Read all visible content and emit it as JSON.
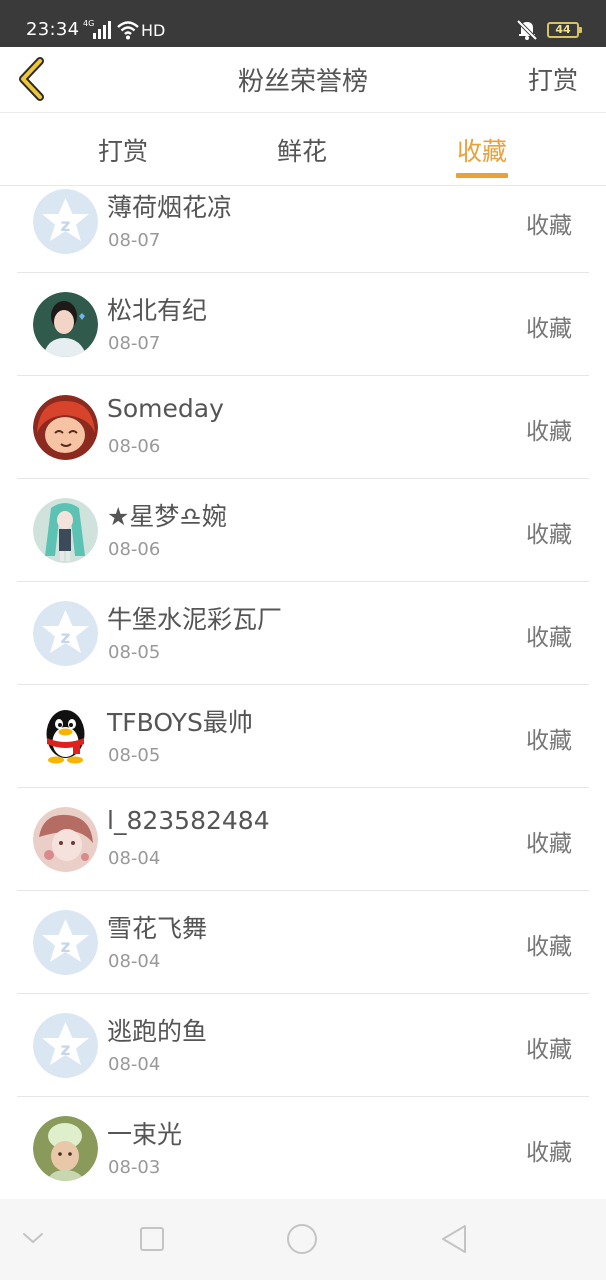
{
  "status": {
    "time": "23:34",
    "network": "4G",
    "hd": "HD",
    "battery": "44"
  },
  "header": {
    "title": "粉丝荣誉榜",
    "action": "打赏"
  },
  "tabs": [
    {
      "label": "打赏",
      "active": false
    },
    {
      "label": "鲜花",
      "active": false
    },
    {
      "label": "收藏",
      "active": true
    }
  ],
  "colors": {
    "accent": "#e9a13c",
    "status_bar": "#3a3a3a"
  },
  "fans": [
    {
      "name": "薄荷烟花凉",
      "date": "08-07",
      "action": "收藏",
      "avatar": "default-star-avatar"
    },
    {
      "name": "松北有纪",
      "date": "08-07",
      "action": "收藏",
      "avatar": "photo-avatar"
    },
    {
      "name": "Someday",
      "date": "08-06",
      "action": "收藏",
      "avatar": "anime-avatar"
    },
    {
      "name": "★星梦♎婉",
      "date": "08-06",
      "action": "收藏",
      "avatar": "anime-avatar"
    },
    {
      "name": "牛堡水泥彩瓦厂",
      "date": "08-05",
      "action": "收藏",
      "avatar": "default-star-avatar"
    },
    {
      "name": "TFBOYS最帅",
      "date": "08-05",
      "action": "收藏",
      "avatar": "penguin-avatar"
    },
    {
      "name": "l_823582484",
      "date": "08-04",
      "action": "收藏",
      "avatar": "illustration-avatar"
    },
    {
      "name": "雪花飞舞",
      "date": "08-04",
      "action": "收藏",
      "avatar": "default-star-avatar"
    },
    {
      "name": "逃跑的鱼",
      "date": "08-04",
      "action": "收藏",
      "avatar": "default-star-avatar"
    },
    {
      "name": "一束光",
      "date": "08-03",
      "action": "收藏",
      "avatar": "photo-avatar"
    }
  ],
  "navbar": [
    "collapse-icon",
    "recents-icon",
    "home-icon",
    "back-icon"
  ]
}
